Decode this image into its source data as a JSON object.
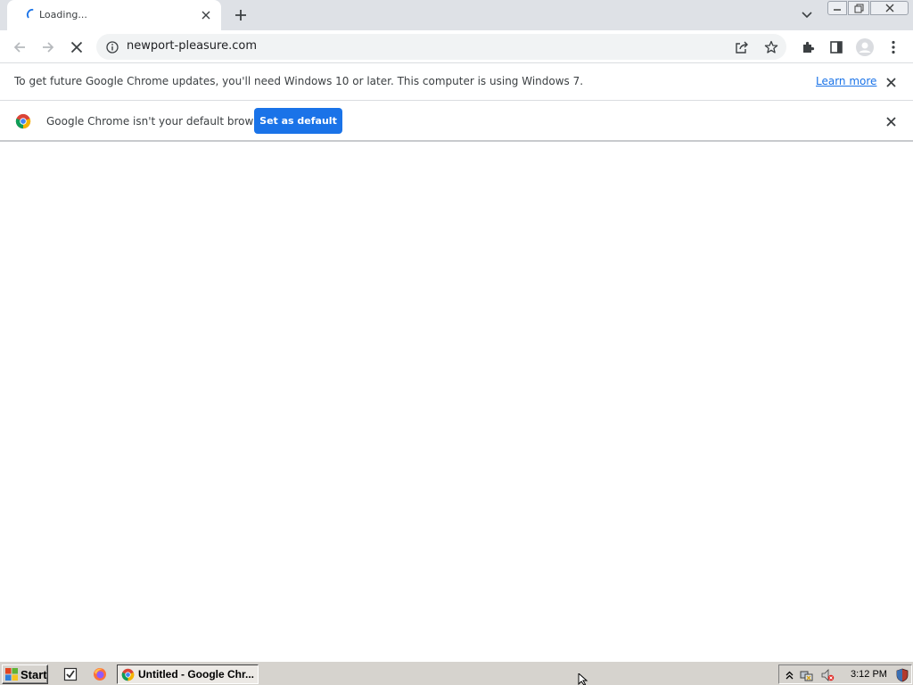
{
  "browser": {
    "tab": {
      "title": "Loading...",
      "state": "loading"
    },
    "address_bar": {
      "url": "newport-pleasure.com"
    }
  },
  "infobars": {
    "update_warning": {
      "message": "To get future Google Chrome updates, you'll need Windows 10 or later. This computer is using Windows 7.",
      "link_label": "Learn more"
    },
    "default_browser": {
      "message": "Google Chrome isn't your default browser",
      "button_label": "Set as default"
    }
  },
  "taskbar": {
    "start_label": "Start",
    "active_task": "Untitled - Google Chr...",
    "clock": "3:12 PM"
  },
  "colors": {
    "accent": "#1a73e8",
    "tabstrip": "#dee1e6",
    "omnibox": "#f1f3f4",
    "taskbar": "#d6d3ce"
  }
}
